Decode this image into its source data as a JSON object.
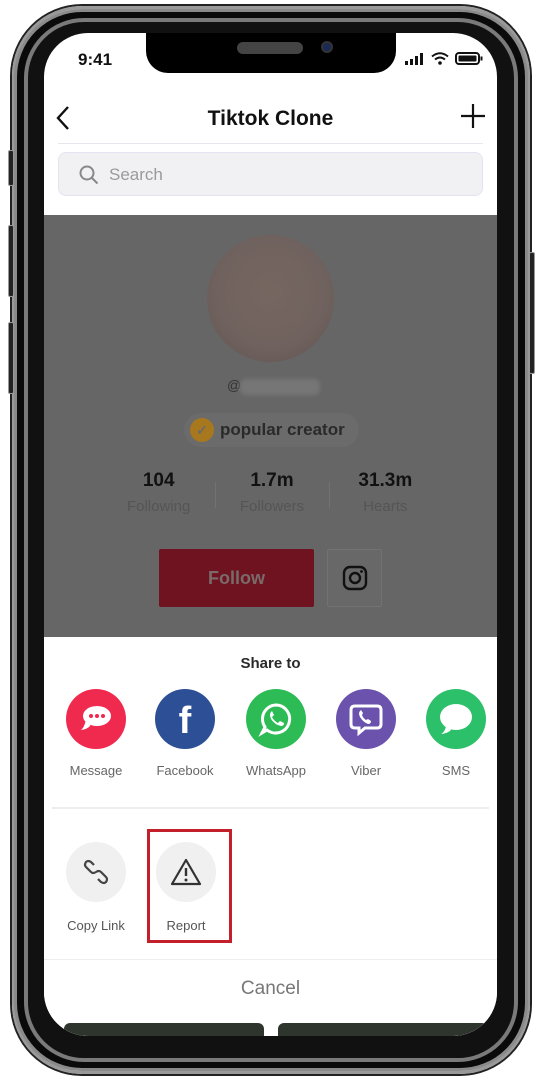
{
  "status_bar": {
    "time": "9:41"
  },
  "nav": {
    "title": "Tiktok Clone",
    "back_icon": "chevron-left-icon",
    "add_icon": "plus-icon"
  },
  "search": {
    "placeholder": "Search",
    "value": ""
  },
  "profile": {
    "handle_prefix": "@",
    "badge": "popular creator",
    "stats": [
      {
        "value": "104",
        "label": "Following"
      },
      {
        "value": "1.7m",
        "label": "Followers"
      },
      {
        "value": "31.3m",
        "label": "Hearts"
      }
    ],
    "follow_label": "Follow"
  },
  "share_sheet": {
    "title": "Share to",
    "targets": [
      {
        "label": "Message",
        "icon": "message-icon",
        "color": "#f0294f"
      },
      {
        "label": "Facebook",
        "icon": "facebook-icon",
        "color": "#2d4f95"
      },
      {
        "label": "WhatsApp",
        "icon": "whatsapp-icon",
        "color": "#2dbb55"
      },
      {
        "label": "Viber",
        "icon": "viber-icon",
        "color": "#6a52ad"
      },
      {
        "label": "SMS",
        "icon": "sms-icon",
        "color": "#2dc06a"
      }
    ],
    "actions": [
      {
        "label": "Copy Link",
        "icon": "link-icon"
      },
      {
        "label": "Report",
        "icon": "warning-icon"
      }
    ],
    "cancel_label": "Cancel",
    "highlight_color": "#c4202b"
  }
}
